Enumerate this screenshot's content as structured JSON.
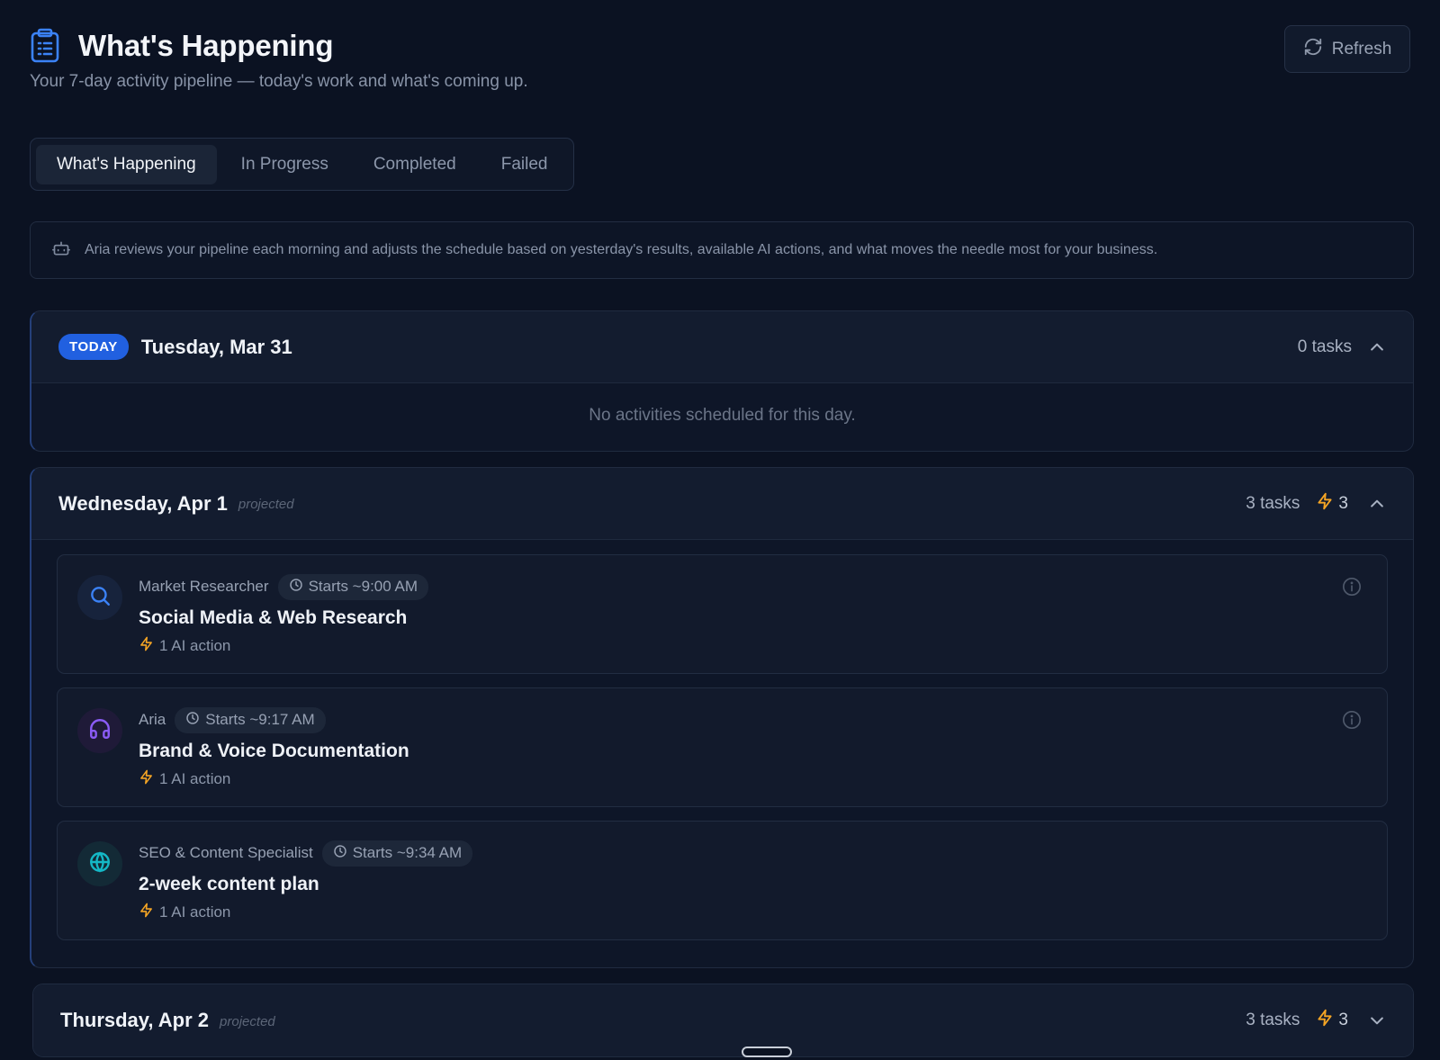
{
  "header": {
    "title": "What's Happening",
    "subtitle": "Your 7-day activity pipeline — today's work and what's coming up.",
    "title_icon": "clipboard-list-icon",
    "refresh_label": "Refresh"
  },
  "tabs": [
    {
      "label": "What's Happening",
      "active": true
    },
    {
      "label": "In Progress",
      "active": false
    },
    {
      "label": "Completed",
      "active": false
    },
    {
      "label": "Failed",
      "active": false
    }
  ],
  "banner": {
    "icon": "bot-icon",
    "text": "Aria reviews your pipeline each morning and adjusts the schedule based on yesterday's results, available AI actions, and what moves the needle most for your business."
  },
  "days": [
    {
      "badge": "TODAY",
      "date": "Tuesday, Mar 31",
      "tasks_label": "0 tasks",
      "empty_text": "No activities scheduled for this day.",
      "expanded": true
    },
    {
      "date": "Wednesday, Apr 1",
      "projected": "projected",
      "tasks_label": "3 tasks",
      "ai_count": "3",
      "expanded": true,
      "tasks": [
        {
          "agent": "Market Researcher",
          "starts": "Starts ~9:00 AM",
          "title": "Social Media & Web Research",
          "ai_action": "1 AI action",
          "icon": "search-icon",
          "icon_color": "#3b82f6",
          "avatar_bg": "#17233c"
        },
        {
          "agent": "Aria",
          "starts": "Starts ~9:17 AM",
          "title": "Brand & Voice Documentation",
          "ai_action": "1 AI action",
          "icon": "headphones-icon",
          "icon_color": "#8b5cf6",
          "avatar_bg": "#1f1a38"
        },
        {
          "agent": "SEO & Content Specialist",
          "starts": "Starts ~9:34 AM",
          "title": "2-week content plan",
          "ai_action": "1 AI action",
          "icon": "globe-icon",
          "icon_color": "#14b8c6",
          "avatar_bg": "#132a36"
        }
      ]
    },
    {
      "date": "Thursday, Apr 2",
      "projected": "projected",
      "tasks_label": "3 tasks",
      "ai_count": "3",
      "expanded": false
    }
  ],
  "colors": {
    "accent": "#2160e0",
    "bolt": "#f5a524",
    "background": "#0b1222"
  }
}
